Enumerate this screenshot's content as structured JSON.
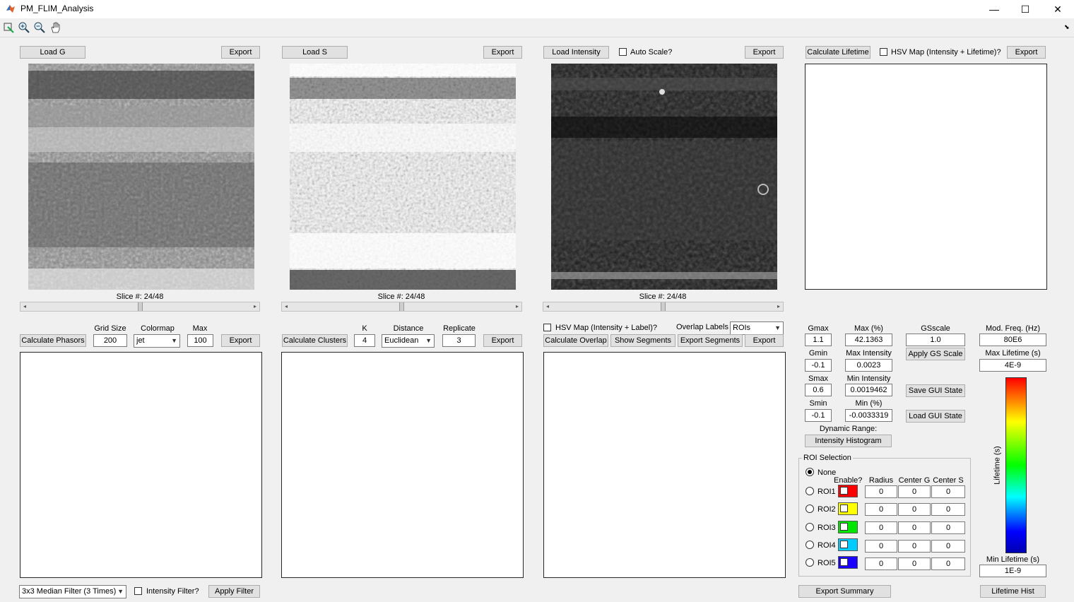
{
  "window": {
    "title": "PM_FLIM_Analysis",
    "minimize": "—",
    "maximize": "☐",
    "close": "✕"
  },
  "toolbar": {
    "icons": [
      "data-cursor-icon",
      "zoom-in-icon",
      "zoom-out-icon",
      "pan-hand-icon"
    ]
  },
  "panel_g": {
    "load_label": "Load G",
    "export_label": "Export",
    "slice_label": "Slice #: 24/48",
    "slider_value": 0.5
  },
  "panel_s": {
    "load_label": "Load S",
    "export_label": "Export",
    "slice_label": "Slice #: 24/48",
    "slider_value": 0.5
  },
  "panel_i": {
    "load_label": "Load Intensity",
    "auto_scale_label": "Auto Scale?",
    "export_label": "Export",
    "slice_label": "Slice #: 24/48",
    "slider_value": 0.5
  },
  "panel_lifetime": {
    "calc_label": "Calculate Lifetime",
    "hsv_label": "HSV Map (Intensity + Lifetime)?",
    "export_label": "Export"
  },
  "phasor": {
    "calc_label": "Calculate Phasors",
    "grid_size_label": "Grid Size",
    "grid_size_value": "200",
    "colormap_label": "Colormap",
    "colormap_value": "jet",
    "max_label": "Max",
    "max_value": "100",
    "export_label": "Export"
  },
  "clusters": {
    "calc_label": "Calculate Clusters",
    "k_label": "K",
    "k_value": "4",
    "distance_label": "Distance",
    "distance_value": "Euclidean",
    "replicate_label": "Replicate",
    "replicate_value": "3",
    "export_label": "Export"
  },
  "overlay": {
    "hsv_label": "HSV Map (Intensity + Label)?",
    "overlap_labels_label": "Overlap Labels",
    "overlap_value": "ROIs",
    "calc_overlap_label": "Calculate Overlap",
    "show_segments_label": "Show Segments",
    "export_segments_label": "Export Segments",
    "export_label": "Export"
  },
  "filter": {
    "filter_value": "3x3 Median Filter (3 Times)",
    "intensity_filter_label": "Intensity Filter?",
    "apply_label": "Apply Filter"
  },
  "params": {
    "gmax_label": "Gmax",
    "gmax": "1.1",
    "gmin_label": "Gmin",
    "gmin": "-0.1",
    "smax_label": "Smax",
    "smax": "0.6",
    "smin_label": "Smin",
    "smin": "-0.1",
    "maxpct_label": "Max (%)",
    "maxpct": "42.1363",
    "maxint_label": "Max Intensity",
    "maxint": "0.0023",
    "minint_label": "Min Intensity",
    "minint": "0.0019462",
    "minpct_label": "Min (%)",
    "minpct": "-0.0033319",
    "gsscale_label": "GSscale",
    "gsscale": "1.0",
    "apply_gs_label": "Apply GS Scale",
    "save_gui_label": "Save GUI State",
    "load_gui_label": "Load GUI State",
    "dynamic_range_label": "Dynamic Range:",
    "intensity_hist_label": "Intensity Histogram",
    "modfreq_label": "Mod. Freq. (Hz)",
    "modfreq": "80E6",
    "maxlife_label": "Max Lifetime (s)",
    "maxlife": "4E-9",
    "minlife_label": "Min Lifetime (s)",
    "minlife": "1E-9",
    "colorbar_label": "Lifetime (s)",
    "lifetime_hist_label": "Lifetime Hist",
    "export_summary_label": "Export Summary"
  },
  "roi": {
    "title": "ROI Selection",
    "none_label": "None",
    "headers": {
      "enable": "Enable?",
      "radius": "Radius",
      "center_g": "Center G",
      "center_s": "Center S"
    },
    "rows": [
      {
        "label": "ROI1",
        "color": "#ff0000",
        "radius": "0",
        "center_g": "0",
        "center_s": "0"
      },
      {
        "label": "ROI2",
        "color": "#ffff00",
        "radius": "0",
        "center_g": "0",
        "center_s": "0"
      },
      {
        "label": "ROI3",
        "color": "#00e600",
        "radius": "0",
        "center_g": "0",
        "center_s": "0"
      },
      {
        "label": "ROI4",
        "color": "#00ccff",
        "radius": "0",
        "center_g": "0",
        "center_s": "0"
      },
      {
        "label": "ROI5",
        "color": "#1a00ff",
        "radius": "0",
        "center_g": "0",
        "center_s": "0"
      }
    ]
  }
}
